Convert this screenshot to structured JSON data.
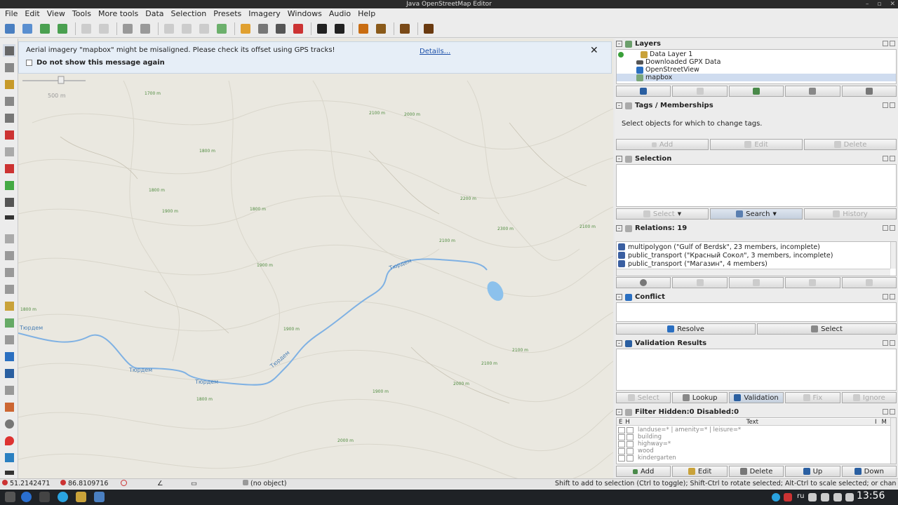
{
  "window": {
    "title": "Java OpenStreetMap Editor",
    "controls": [
      "–",
      "▫",
      "✕"
    ]
  },
  "menu": [
    "File",
    "Edit",
    "View",
    "Tools",
    "More tools",
    "Data",
    "Selection",
    "Presets",
    "Imagery",
    "Windows",
    "Audio",
    "Help"
  ],
  "notice": {
    "message": "Aerial imagery \"mapbox\" might be misaligned. Please check its offset using GPS tracks!",
    "details": "Details...",
    "close": "✕",
    "checkbox_label": "Do not show this message again"
  },
  "map": {
    "scale_label": "500 m",
    "river_label": "Тюрдем",
    "contours": [
      "1700 m",
      "1800 m",
      "1900 m",
      "2000 m",
      "2100 m",
      "2200 m",
      "2300 m"
    ],
    "colors": {
      "background": "#eae8e0",
      "river": "#7fb1e3",
      "lake": "#8cc1ec",
      "contour": "#4d8a3d"
    }
  },
  "layers": {
    "title": "Layers",
    "items": [
      "Data Layer 1",
      "Downloaded GPX Data",
      "OpenStreetView",
      "mapbox"
    ]
  },
  "tags": {
    "title": "Tags / Memberships",
    "empty": "Select objects for which to change tags.",
    "buttons": [
      "Add",
      "Edit",
      "Delete"
    ]
  },
  "selection": {
    "title": "Selection",
    "buttons": [
      "Select",
      "Search",
      "History"
    ]
  },
  "relations": {
    "title": "Relations: 19",
    "items": [
      "multipolygon (\"Gulf of Berdsk\", 23 members, incomplete)",
      "public_transport (\"Красный Сокол\", 3 members, incomplete)",
      "public_transport (\"Магазин\", 4 members)"
    ]
  },
  "conflict": {
    "title": "Conflict",
    "buttons": [
      "Resolve",
      "Select"
    ]
  },
  "validation": {
    "title": "Validation Results",
    "buttons": [
      "Select",
      "Lookup",
      "Validation",
      "Fix",
      "Ignore"
    ]
  },
  "filter": {
    "title": "Filter Hidden:0 Disabled:0",
    "col_e": "E",
    "col_h": "H",
    "col_text": "Text",
    "col_i": "I",
    "col_m": "M",
    "rows": [
      "landuse=* | amenity=* | leisure=*",
      "building",
      "highway=*",
      "wood",
      "kindergarten"
    ],
    "buttons": [
      "Add",
      "Edit",
      "Delete",
      "Up",
      "Down"
    ]
  },
  "status": {
    "lat": "51.2142471",
    "lon": "86.8109716",
    "object": "(no object)",
    "hint": "Shift to add to selection (Ctrl to toggle); Shift-Ctrl to rotate selected; Alt-Ctrl to scale selected; or change selection"
  },
  "taskbar": {
    "lang": "ru",
    "clock": "13:56"
  }
}
